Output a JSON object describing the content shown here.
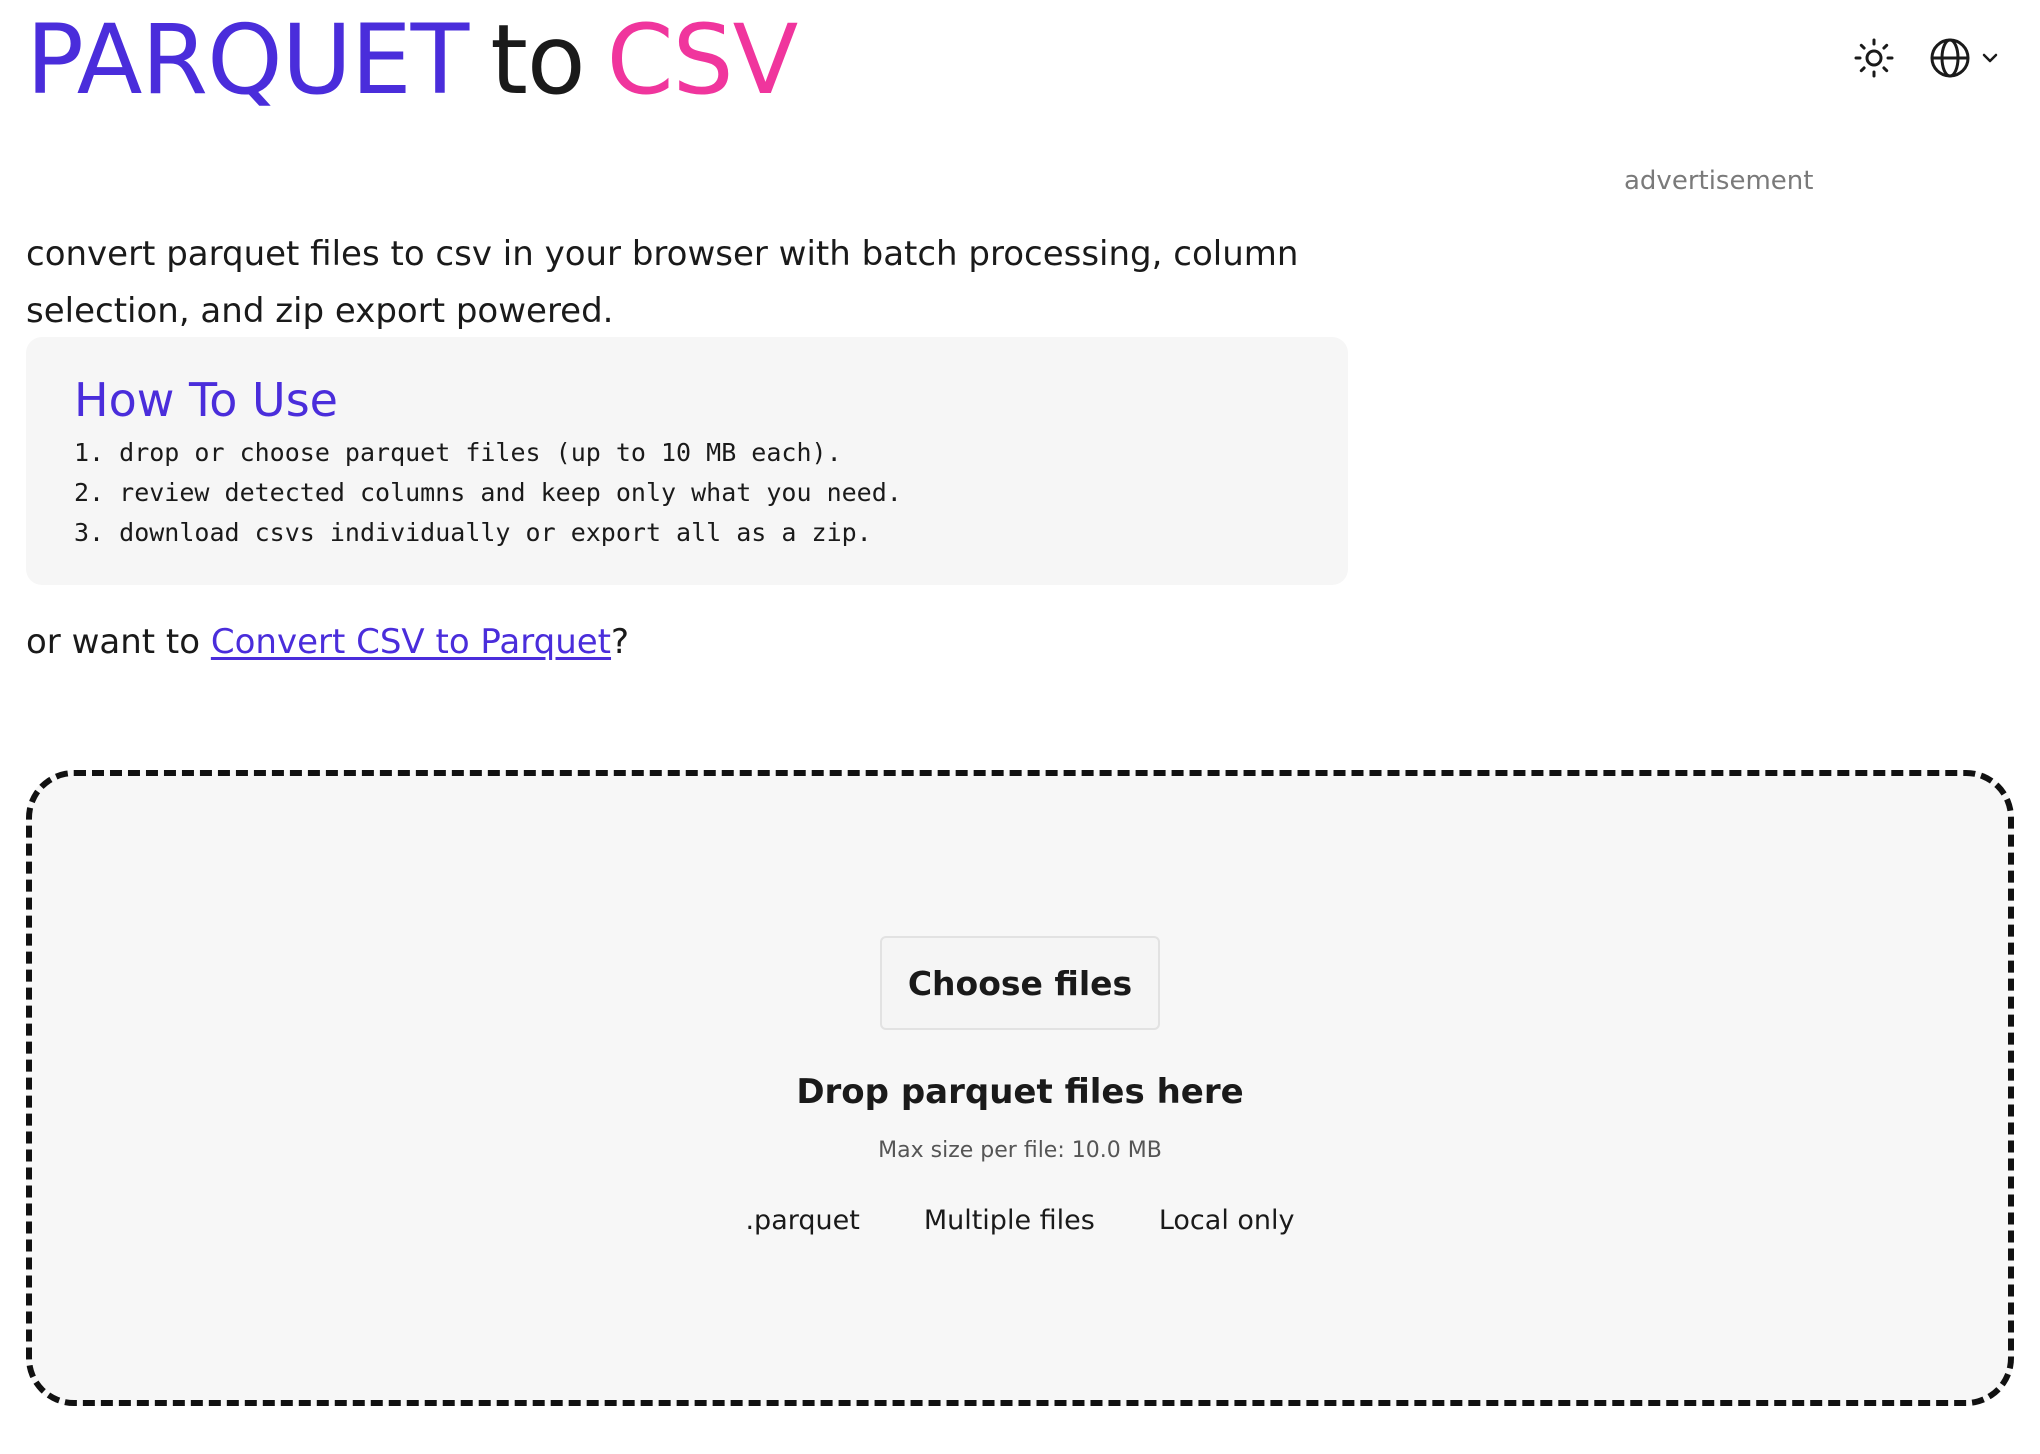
{
  "header": {
    "brand_part1": "PARQUET",
    "brand_part2": "to",
    "brand_part3": "CSV",
    "theme_icon": "sun-icon",
    "language_icon": "globe-icon",
    "language_chevron": "chevron-down-icon"
  },
  "advertisement_label": "advertisement",
  "intro": "convert parquet files to csv in your browser with batch processing, column selection, and zip export powered.",
  "how_to": {
    "title": "How To Use",
    "steps": [
      "1. drop or choose parquet files (up to 10 MB each).",
      "2. review detected columns and keep only what you need.",
      "3. download csvs individually or export all as a zip."
    ]
  },
  "alt": {
    "prefix": "or want to ",
    "link_text": "Convert CSV to Parquet",
    "suffix": "?"
  },
  "dropzone": {
    "choose_label": "Choose files",
    "title": "Drop parquet files here",
    "max_size": "Max size per file: 10.0 MB",
    "chips": [
      ".parquet",
      "Multiple files",
      "Local only"
    ]
  },
  "colors": {
    "brand_blue": "#4a2ddb",
    "brand_pink": "#f0359d"
  }
}
